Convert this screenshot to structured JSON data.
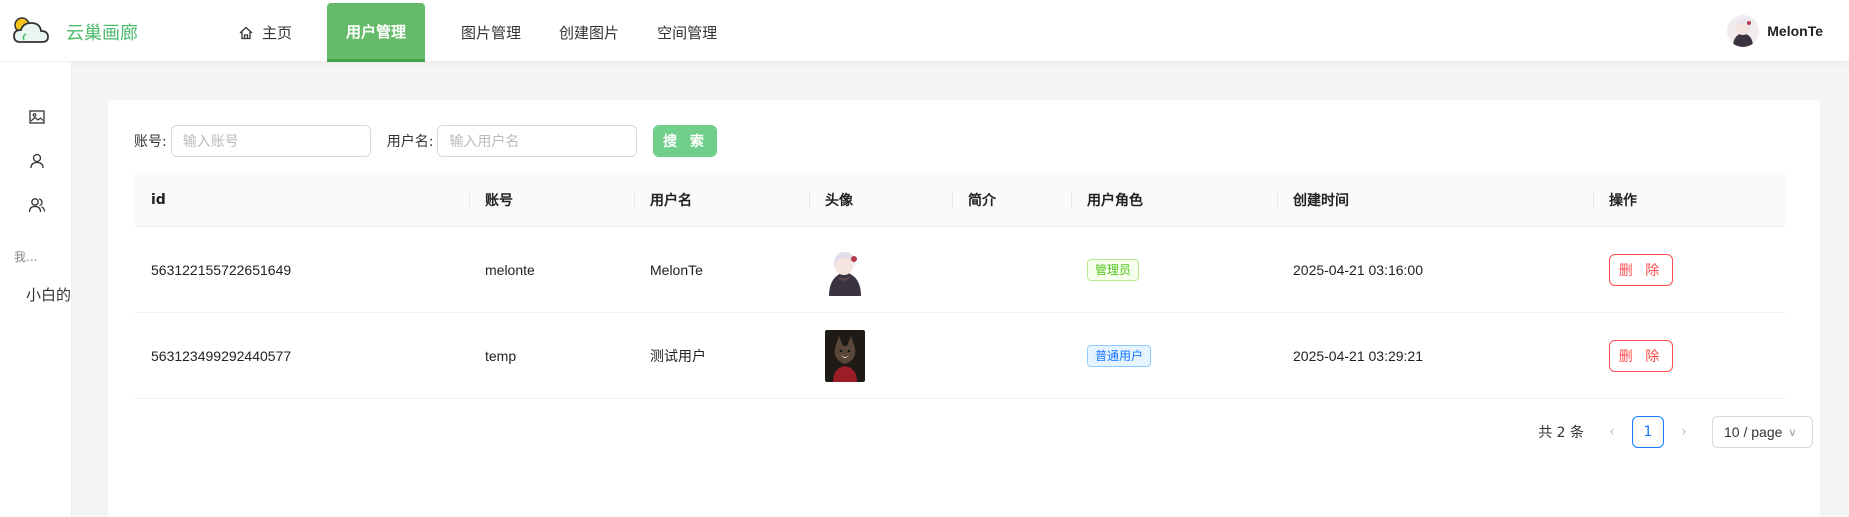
{
  "header": {
    "site_title": "云巢画廊",
    "nav": [
      {
        "label": "主页",
        "icon": "home-icon"
      },
      {
        "label": "用户管理",
        "active": true
      },
      {
        "label": "图片管理"
      },
      {
        "label": "创建图片"
      },
      {
        "label": "空间管理"
      }
    ],
    "user": {
      "name": "MelonTe"
    }
  },
  "sidebar": {
    "icons": [
      "image-icon",
      "user-icon",
      "team-icon"
    ],
    "section_label": "我...",
    "item_label": "小白的"
  },
  "search": {
    "account_label": "账号:",
    "account_placeholder": "输入账号",
    "username_label": "用户名:",
    "username_placeholder": "输入用户名",
    "button_label": "搜 索"
  },
  "table": {
    "columns": [
      "id",
      "账号",
      "用户名",
      "头像",
      "简介",
      "用户角色",
      "创建时间",
      "操作"
    ],
    "rows": [
      {
        "id": "563122155722651649",
        "account": "melonte",
        "username": "MelonTe",
        "intro": "",
        "role": "管理员",
        "role_color": "#52c41a",
        "created": "2025-04-21 03:16:00",
        "action": "删 除"
      },
      {
        "id": "563123499292440577",
        "account": "temp",
        "username": "测试用户",
        "intro": "",
        "role": "普通用户",
        "role_color": "#1677ff",
        "created": "2025-04-21 03:29:21",
        "action": "删 除"
      }
    ]
  },
  "pagination": {
    "total_text": "共 2 条",
    "current_page": "1",
    "page_size": "10 / page"
  },
  "colors": {
    "accent": "#66bb6a",
    "danger": "#ff4d4f",
    "primary": "#1677ff"
  }
}
